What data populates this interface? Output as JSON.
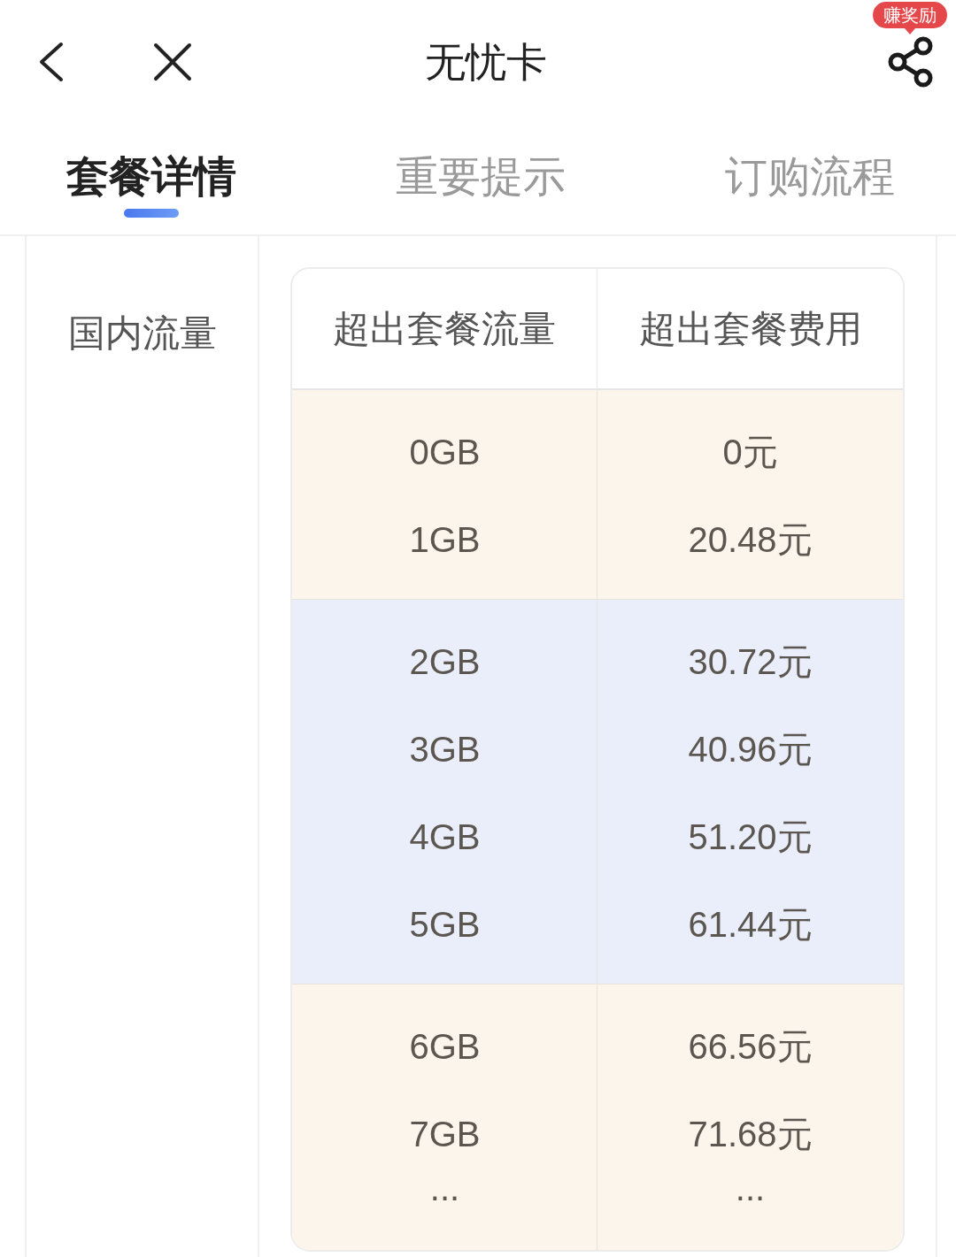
{
  "topbar": {
    "title": "无忧卡",
    "badge": "赚奖励"
  },
  "tabs": [
    {
      "label": "套餐详情",
      "selected": true
    },
    {
      "label": "重要提示",
      "selected": false
    },
    {
      "label": "订购流程",
      "selected": false
    }
  ],
  "section": {
    "label": "国内流量",
    "table": {
      "columns": [
        "超出套餐流量",
        "超出套餐费用"
      ],
      "groups": [
        {
          "color": "#fcf5eb",
          "rows": [
            {
              "kind": "value",
              "cells": [
                "0GB",
                "0元"
              ]
            },
            {
              "kind": "value",
              "cells": [
                "1GB",
                "20.48元"
              ]
            }
          ]
        },
        {
          "color": "#eaeefb",
          "rows": [
            {
              "kind": "value",
              "cells": [
                "2GB",
                "30.72元"
              ]
            },
            {
              "kind": "value",
              "cells": [
                "3GB",
                "40.96元"
              ]
            },
            {
              "kind": "value",
              "cells": [
                "4GB",
                "51.20元"
              ]
            },
            {
              "kind": "value",
              "cells": [
                "5GB",
                "61.44元"
              ]
            }
          ]
        },
        {
          "color": "#fcf5eb",
          "rows": [
            {
              "kind": "value",
              "cells": [
                "6GB",
                "66.56元"
              ]
            },
            {
              "kind": "value",
              "cells": [
                "7GB",
                "71.68元"
              ]
            },
            {
              "kind": "more",
              "cells": [
                "...",
                "..."
              ]
            }
          ]
        }
      ]
    }
  }
}
